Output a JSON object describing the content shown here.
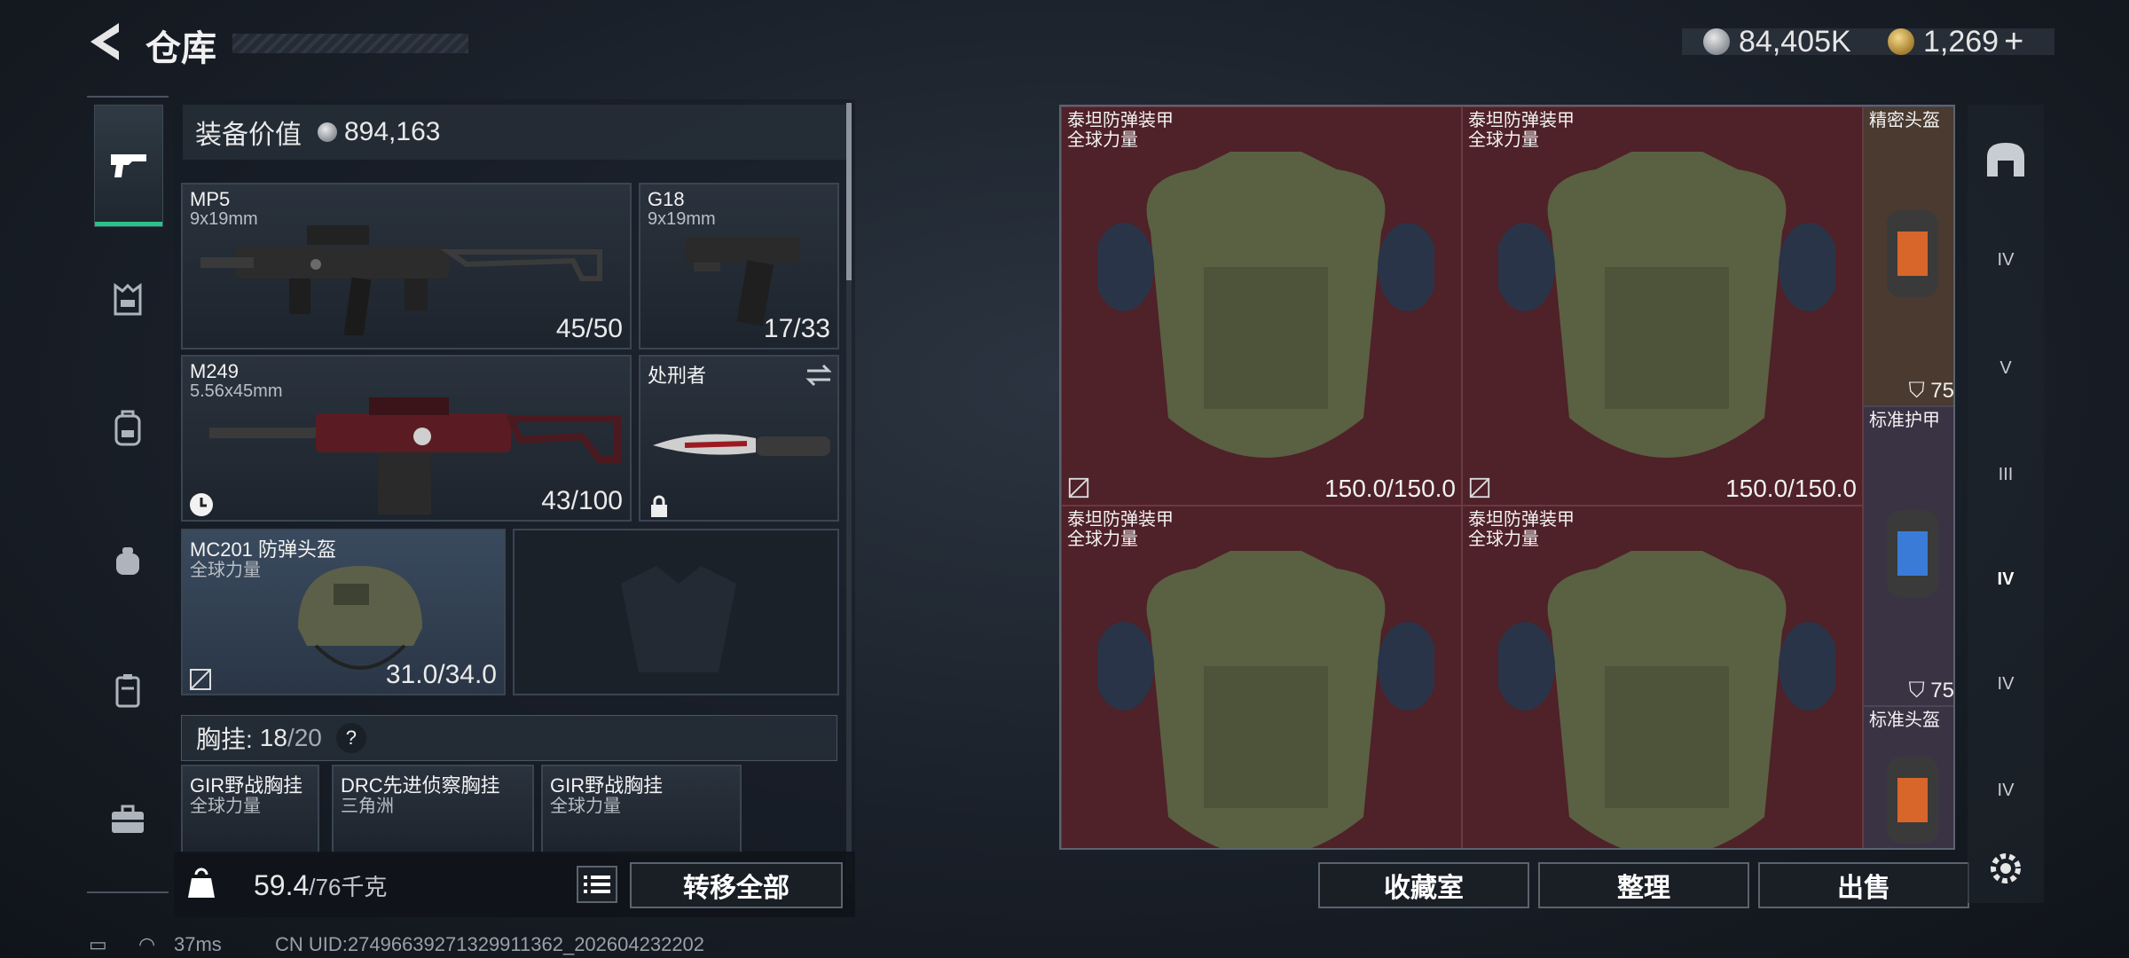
{
  "header": {
    "title": "仓库",
    "currency_silver": "84,405K",
    "currency_gold": "1,269"
  },
  "left_panel": {
    "equipment_value_label": "装备价值",
    "equipment_value": "894,163",
    "slots": [
      {
        "name": "MP5",
        "ammo": "9x19mm",
        "count": "45/50"
      },
      {
        "name": "G18",
        "ammo": "9x19mm",
        "count": "17/33"
      },
      {
        "name": "M249",
        "ammo": "5.56x45mm",
        "count": "43/100"
      },
      {
        "name": "处刑者"
      },
      {
        "name": "MC201 防弹头盔",
        "sub": "全球力量",
        "count": "31.0/34.0"
      }
    ],
    "chest_rig_label": "胸挂:",
    "chest_rig_used": "18",
    "chest_rig_total": "/20",
    "chest_help": "?",
    "rigs": [
      {
        "name": "GIR野战胸挂",
        "sub": "全球力量"
      },
      {
        "name": "DRC先进侦察胸挂",
        "sub": "三角洲"
      },
      {
        "name": "GIR野战胸挂",
        "sub": "全球力量"
      }
    ],
    "weight_used": "59.4",
    "weight_total": "/76千克",
    "transfer_all": "转移全部"
  },
  "stash": {
    "items": [
      {
        "name": "泰坦防弹装甲",
        "sub": "全球力量",
        "durability": "150.0/150.0"
      },
      {
        "name": "泰坦防弹装甲",
        "sub": "全球力量",
        "durability": "150.0/150.0"
      },
      {
        "name": "泰坦防弹装甲",
        "sub": "全球力量"
      },
      {
        "name": "泰坦防弹装甲",
        "sub": "全球力量"
      }
    ],
    "side_items": [
      {
        "name": "精密头盔",
        "armor": "75"
      },
      {
        "name": "标准护甲",
        "armor": "75"
      },
      {
        "name": "标准头盔"
      }
    ],
    "buttons": {
      "collection": "收藏室",
      "organize": "整理",
      "sell": "出售"
    }
  },
  "right_rail": [
    "IV",
    "V",
    "III",
    "IV",
    "IV",
    "IV"
  ],
  "status_bar": {
    "ping": "37ms",
    "uid": "CN UID:2749663927132991136​2_202604232202"
  }
}
